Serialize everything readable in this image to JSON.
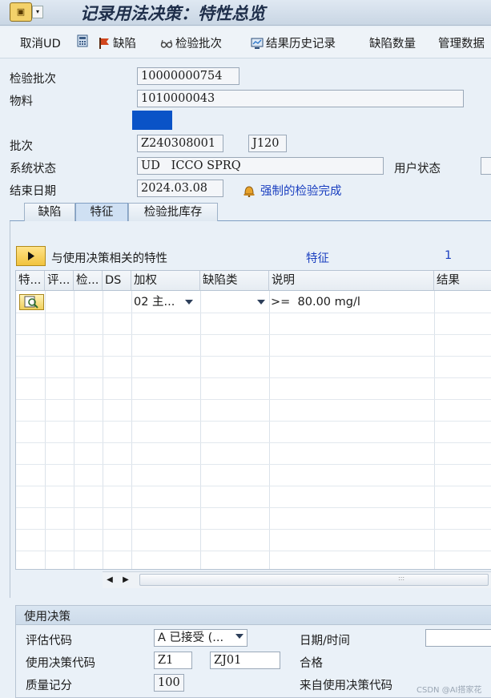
{
  "header": {
    "title": "记录用法决策：特性总览",
    "app_icon": "sap-app-icon"
  },
  "toolbar": {
    "cancel_ud": "取消UD",
    "defects": "缺陷",
    "inspection_lot": "检验批次",
    "result_history": "结果历史记录",
    "defect_qty": "缺陷数量",
    "manage_data": "管理数据"
  },
  "form": {
    "inspection_lot_label": "检验批次",
    "inspection_lot_value": "10000000754",
    "material_label": "物料",
    "material_value": "1010000043",
    "batch_label": "批次",
    "batch_value": "Z240308001",
    "plant_value": "J120",
    "system_status_label": "系统状态",
    "system_status_value": "UD   ICCO SPRQ",
    "user_status_label": "用户状态",
    "end_date_label": "结束日期",
    "end_date_value": "2024.03.08",
    "forced_completion_link": "强制的检验完成"
  },
  "tabs": [
    "缺陷",
    "特征",
    "检验批库存"
  ],
  "characteristics": {
    "group_label": "与使用决策相关的特性",
    "filter_label": "特征",
    "count": "1",
    "columns": [
      "特...",
      "评...",
      "检...",
      "DS",
      "加权",
      "缺陷类",
      "说明",
      "结果"
    ],
    "rows": [
      {
        "weight": "02 主...",
        "defect_class": "",
        "description": ">=  80.00 mg/l",
        "result": ""
      }
    ]
  },
  "usage_decision": {
    "section_title": "使用决策",
    "valuation_code_label": "评估代码",
    "valuation_code_value": "A 已接受 (...",
    "date_time_label": "日期/时间",
    "ud_code_label": "使用决策代码",
    "ud_code_value1": "Z1",
    "ud_code_value2": "ZJ01",
    "ud_code_text": "合格",
    "quality_score_label": "质量记分",
    "quality_score_value": "100",
    "from_ud_code_label": "来自使用决策代码"
  },
  "watermark": "CSDN @AI搭家花",
  "colors": {
    "accent": "#0a53c7",
    "link": "#1a3fc0",
    "highlight_block": "#0a53c7"
  }
}
